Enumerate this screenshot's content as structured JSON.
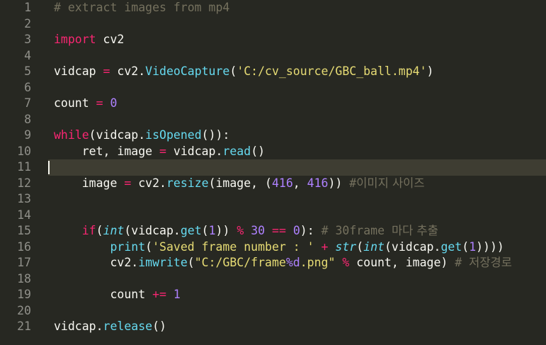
{
  "editor": {
    "theme_colors": {
      "background": "#272822",
      "comment": "#75715e",
      "keyword": "#f92672",
      "function": "#66d9ef",
      "string": "#e6db74",
      "number": "#ae81ff",
      "text": "#f8f8f2",
      "gutter": "#90908a"
    },
    "current_line": 11,
    "lines": [
      {
        "num": "1",
        "tokens": [
          {
            "t": "# extract images from mp4",
            "c": "c"
          }
        ]
      },
      {
        "num": "2",
        "tokens": []
      },
      {
        "num": "3",
        "tokens": [
          {
            "t": "import",
            "c": "k"
          },
          {
            "t": " cv2",
            "c": "p"
          }
        ]
      },
      {
        "num": "4",
        "tokens": []
      },
      {
        "num": "5",
        "tokens": [
          {
            "t": "vidcap ",
            "c": "p"
          },
          {
            "t": "=",
            "c": "o"
          },
          {
            "t": " cv2.",
            "c": "p"
          },
          {
            "t": "VideoCapture",
            "c": "f"
          },
          {
            "t": "(",
            "c": "p"
          },
          {
            "t": "'C:/cv_source/GBC_ball.mp4'",
            "c": "s"
          },
          {
            "t": ")",
            "c": "p"
          }
        ]
      },
      {
        "num": "6",
        "tokens": []
      },
      {
        "num": "7",
        "tokens": [
          {
            "t": "count ",
            "c": "p"
          },
          {
            "t": "=",
            "c": "o"
          },
          {
            "t": " ",
            "c": "p"
          },
          {
            "t": "0",
            "c": "n"
          }
        ]
      },
      {
        "num": "8",
        "tokens": []
      },
      {
        "num": "9",
        "tokens": [
          {
            "t": "while",
            "c": "k"
          },
          {
            "t": "(vidcap.",
            "c": "p"
          },
          {
            "t": "isOpened",
            "c": "f"
          },
          {
            "t": "()):",
            "c": "p"
          }
        ]
      },
      {
        "num": "10",
        "tokens": [
          {
            "t": "    ret, image ",
            "c": "p"
          },
          {
            "t": "=",
            "c": "o"
          },
          {
            "t": " vidcap.",
            "c": "p"
          },
          {
            "t": "read",
            "c": "f"
          },
          {
            "t": "()",
            "c": "p"
          }
        ]
      },
      {
        "num": "11",
        "tokens": []
      },
      {
        "num": "12",
        "tokens": [
          {
            "t": "    image ",
            "c": "p"
          },
          {
            "t": "=",
            "c": "o"
          },
          {
            "t": " cv2.",
            "c": "p"
          },
          {
            "t": "resize",
            "c": "f"
          },
          {
            "t": "(image, (",
            "c": "p"
          },
          {
            "t": "416",
            "c": "n"
          },
          {
            "t": ", ",
            "c": "p"
          },
          {
            "t": "416",
            "c": "n"
          },
          {
            "t": ")) ",
            "c": "p"
          },
          {
            "t": "#",
            "c": "c"
          },
          {
            "t": "이미지 사이즈",
            "c": "c ko"
          }
        ]
      },
      {
        "num": "13",
        "tokens": []
      },
      {
        "num": "14",
        "tokens": []
      },
      {
        "num": "15",
        "tokens": [
          {
            "t": "    ",
            "c": "p"
          },
          {
            "t": "if",
            "c": "k"
          },
          {
            "t": "(",
            "c": "p"
          },
          {
            "t": "int",
            "c": "i"
          },
          {
            "t": "(vidcap.",
            "c": "p"
          },
          {
            "t": "get",
            "c": "f"
          },
          {
            "t": "(",
            "c": "p"
          },
          {
            "t": "1",
            "c": "n"
          },
          {
            "t": ")) ",
            "c": "p"
          },
          {
            "t": "%",
            "c": "o"
          },
          {
            "t": " ",
            "c": "p"
          },
          {
            "t": "30",
            "c": "n"
          },
          {
            "t": " ",
            "c": "p"
          },
          {
            "t": "==",
            "c": "o"
          },
          {
            "t": " ",
            "c": "p"
          },
          {
            "t": "0",
            "c": "n"
          },
          {
            "t": "): ",
            "c": "p"
          },
          {
            "t": "# 30frame ",
            "c": "c"
          },
          {
            "t": "마다 추출",
            "c": "c ko"
          }
        ]
      },
      {
        "num": "16",
        "tokens": [
          {
            "t": "        ",
            "c": "p"
          },
          {
            "t": "print",
            "c": "f"
          },
          {
            "t": "(",
            "c": "p"
          },
          {
            "t": "'Saved frame number : '",
            "c": "s"
          },
          {
            "t": " ",
            "c": "p"
          },
          {
            "t": "+",
            "c": "o"
          },
          {
            "t": " ",
            "c": "p"
          },
          {
            "t": "str",
            "c": "i"
          },
          {
            "t": "(",
            "c": "p"
          },
          {
            "t": "int",
            "c": "i"
          },
          {
            "t": "(vidcap.",
            "c": "p"
          },
          {
            "t": "get",
            "c": "f"
          },
          {
            "t": "(",
            "c": "p"
          },
          {
            "t": "1",
            "c": "n"
          },
          {
            "t": "))))",
            "c": "p"
          }
        ]
      },
      {
        "num": "17",
        "tokens": [
          {
            "t": "        cv2.",
            "c": "p"
          },
          {
            "t": "imwrite",
            "c": "f"
          },
          {
            "t": "(",
            "c": "p"
          },
          {
            "t": "\"C:/GBC/frame",
            "c": "s"
          },
          {
            "t": "%d",
            "c": "n"
          },
          {
            "t": ".png\"",
            "c": "s"
          },
          {
            "t": " ",
            "c": "p"
          },
          {
            "t": "%",
            "c": "o"
          },
          {
            "t": " count, image) ",
            "c": "p"
          },
          {
            "t": "# ",
            "c": "c"
          },
          {
            "t": "저장경로",
            "c": "c ko"
          }
        ]
      },
      {
        "num": "18",
        "tokens": []
      },
      {
        "num": "19",
        "tokens": [
          {
            "t": "        count ",
            "c": "p"
          },
          {
            "t": "+=",
            "c": "o"
          },
          {
            "t": " ",
            "c": "p"
          },
          {
            "t": "1",
            "c": "n"
          }
        ]
      },
      {
        "num": "20",
        "tokens": []
      },
      {
        "num": "21",
        "tokens": [
          {
            "t": "vidcap.",
            "c": "p"
          },
          {
            "t": "release",
            "c": "f"
          },
          {
            "t": "()",
            "c": "p"
          }
        ]
      }
    ]
  }
}
